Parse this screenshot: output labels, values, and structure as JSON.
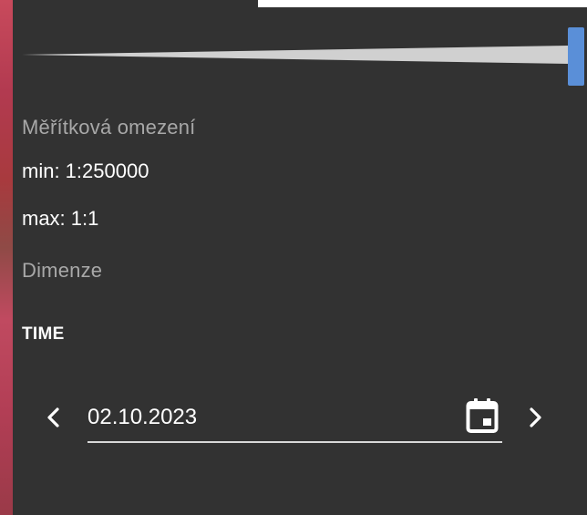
{
  "layer_panel": {
    "opacity_slider": {
      "value_fraction": 1.0,
      "handle_color": "#5a8fd8",
      "wedge_color": "#d0d0d0"
    },
    "scale_limits": {
      "heading": "Měřítková omezení",
      "min_label": "min: 1:250000",
      "max_label": "max: 1:1"
    },
    "dimensions": {
      "heading": "Dimenze",
      "time": {
        "label": "TIME",
        "date_value": "02.10.2023",
        "prev_icon": "chevron-left-icon",
        "next_icon": "chevron-right-icon",
        "calendar_icon": "calendar-icon"
      }
    }
  },
  "colors": {
    "panel_background": "#323232",
    "heading_text": "#a8a8a8",
    "value_text": "#ffffff",
    "accent": "#5a8fd8"
  }
}
